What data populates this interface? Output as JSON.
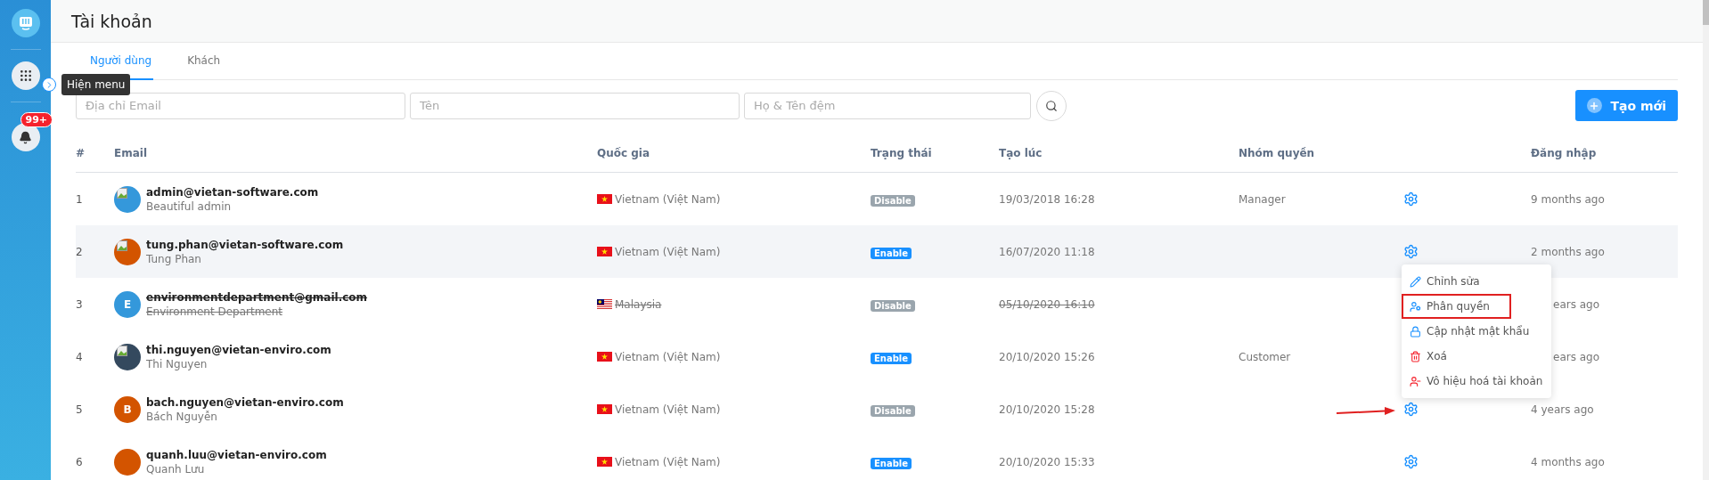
{
  "sidebar": {
    "badge": "99+"
  },
  "tooltip": "Hiện menu",
  "page_title": "Tài khoản",
  "tabs": [
    {
      "label": "Người dùng",
      "selected": true
    },
    {
      "label": "Khách",
      "selected": false
    }
  ],
  "filters": [
    {
      "placeholder": "Địa chỉ Email"
    },
    {
      "placeholder": "Tên"
    },
    {
      "placeholder": "Họ & Tên đệm"
    }
  ],
  "create_button": "Tạo mới",
  "table": {
    "columns": [
      "#",
      "Email",
      "Quốc gia",
      "Trạng thái",
      "Tạo lúc",
      "Nhóm quyền",
      "",
      "Đăng nhập"
    ],
    "rows": [
      {
        "index": "1",
        "email": "admin@vietan-software.com",
        "name": "Beautiful admin",
        "avatar": {
          "kind": "image",
          "color": "#3498db"
        },
        "flag": {
          "kind": "vn"
        },
        "country": "Vietnam (Việt Nam)",
        "status": "Disable",
        "enabled": false,
        "created": "19/03/2018 16:28",
        "group": "Manager",
        "login": "9 months ago",
        "deleted": false,
        "hovered": false,
        "login_covered": false
      },
      {
        "index": "2",
        "email": "tung.phan@vietan-software.com",
        "name": "Tung Phan",
        "avatar": {
          "kind": "image",
          "color": "#d35400"
        },
        "flag": {
          "kind": "vn"
        },
        "country": "Vietnam (Việt Nam)",
        "status": "Enable",
        "enabled": true,
        "created": "16/07/2020 11:18",
        "login": "2 months ago",
        "deleted": false,
        "hovered": true,
        "login_covered": false
      },
      {
        "index": "3",
        "email": "environmentdepartment@gmail.com",
        "name": "Environment Department",
        "avatar": {
          "kind": "letter",
          "letter": "E",
          "color": "#3498db"
        },
        "flag": {
          "kind": "my"
        },
        "country": "Malaysia",
        "status": "Disable",
        "enabled": false,
        "created": "05/10/2020 16:10",
        "login": "ears ago",
        "deleted": true,
        "hovered": false,
        "login_covered": true
      },
      {
        "index": "4",
        "email": "thi.nguyen@vietan-enviro.com",
        "name": "Thi Nguyen",
        "avatar": {
          "kind": "image",
          "color": "#34495e"
        },
        "flag": {
          "kind": "vn"
        },
        "country": "Vietnam (Việt Nam)",
        "status": "Enable",
        "enabled": true,
        "created": "20/10/2020 15:26",
        "group": "Customer",
        "login": "ears ago",
        "deleted": false,
        "hovered": false,
        "login_covered": true
      },
      {
        "index": "5",
        "email": "bach.nguyen@vietan-enviro.com",
        "name": "Bách Nguyễn",
        "avatar": {
          "kind": "letter",
          "letter": "B",
          "color": "#d35400"
        },
        "flag": {
          "kind": "vn"
        },
        "country": "Vietnam (Việt Nam)",
        "status": "Disable",
        "enabled": false,
        "created": "20/10/2020 15:28",
        "login": "4 years ago",
        "deleted": false,
        "hovered": false,
        "login_covered": false
      },
      {
        "index": "6",
        "email": "quanh.luu@vietan-enviro.com",
        "name": "Quanh Lưu",
        "avatar": {
          "kind": "blank",
          "color": "#d35400"
        },
        "flag": {
          "kind": "vn"
        },
        "country": "Vietnam (Việt Nam)",
        "status": "Enable",
        "enabled": true,
        "created": "20/10/2020 15:33",
        "login": "4 months ago",
        "deleted": false,
        "hovered": false,
        "login_covered": false
      }
    ]
  },
  "action_menu": {
    "items": [
      {
        "kind": "edit",
        "label": "Chỉnh sửa",
        "highlighted": false
      },
      {
        "kind": "permission",
        "label": "Phân quyền",
        "highlighted": true
      },
      {
        "kind": "password",
        "label": "Cập nhật mật khẩu",
        "highlighted": false
      },
      {
        "kind": "delete",
        "label": "Xoá",
        "highlighted": false
      },
      {
        "kind": "disable",
        "label": "Vô hiệu hoá tài khoản",
        "highlighted": false
      }
    ]
  }
}
